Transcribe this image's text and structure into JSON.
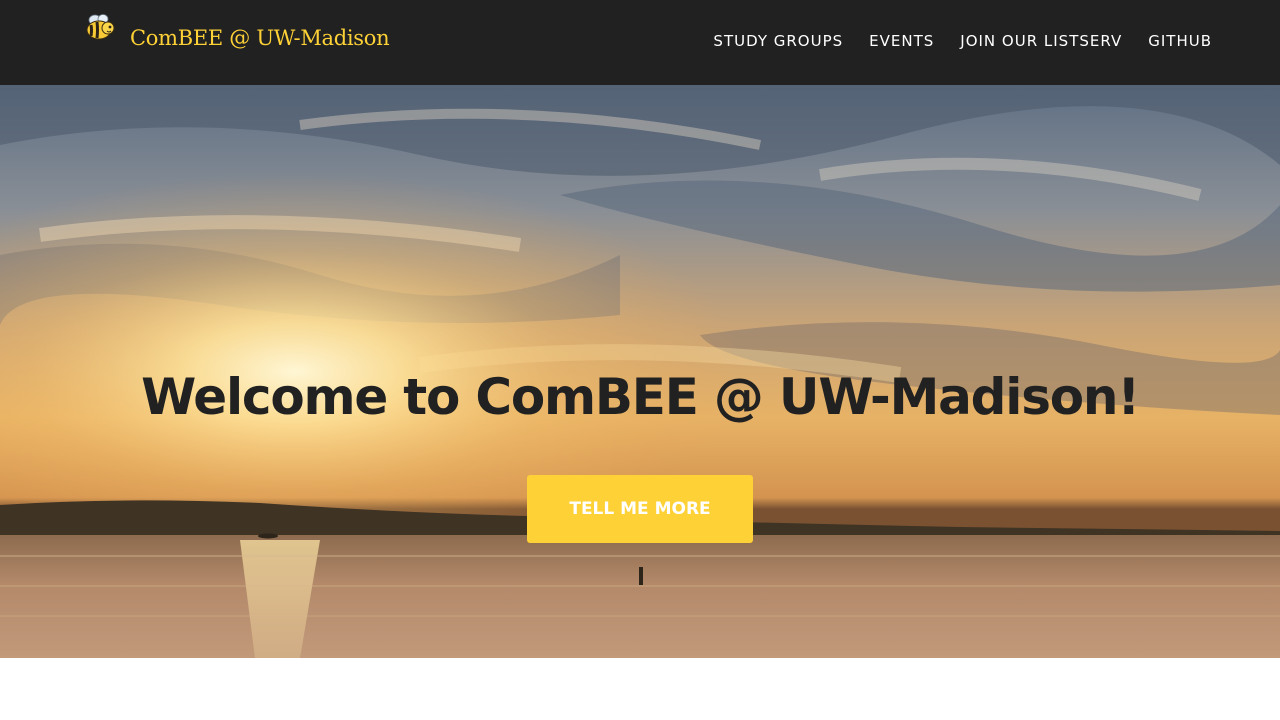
{
  "brand": {
    "title": "ComBEE @ UW-Madison",
    "logo_icon": "bee-icon",
    "color": "#fed136"
  },
  "nav": {
    "items": [
      {
        "label": "STUDY GROUPS"
      },
      {
        "label": "EVENTS"
      },
      {
        "label": "JOIN OUR LISTSERV"
      },
      {
        "label": "GITHUB"
      }
    ]
  },
  "hero": {
    "title": "Welcome to ComBEE @ UW-Madison!",
    "button_label": "TELL ME MORE",
    "accent": "#fed136",
    "background_image": "sunset-over-lake"
  },
  "colors": {
    "navbar": "#212121",
    "heading": "#212121",
    "button_text": "#ffffff"
  }
}
